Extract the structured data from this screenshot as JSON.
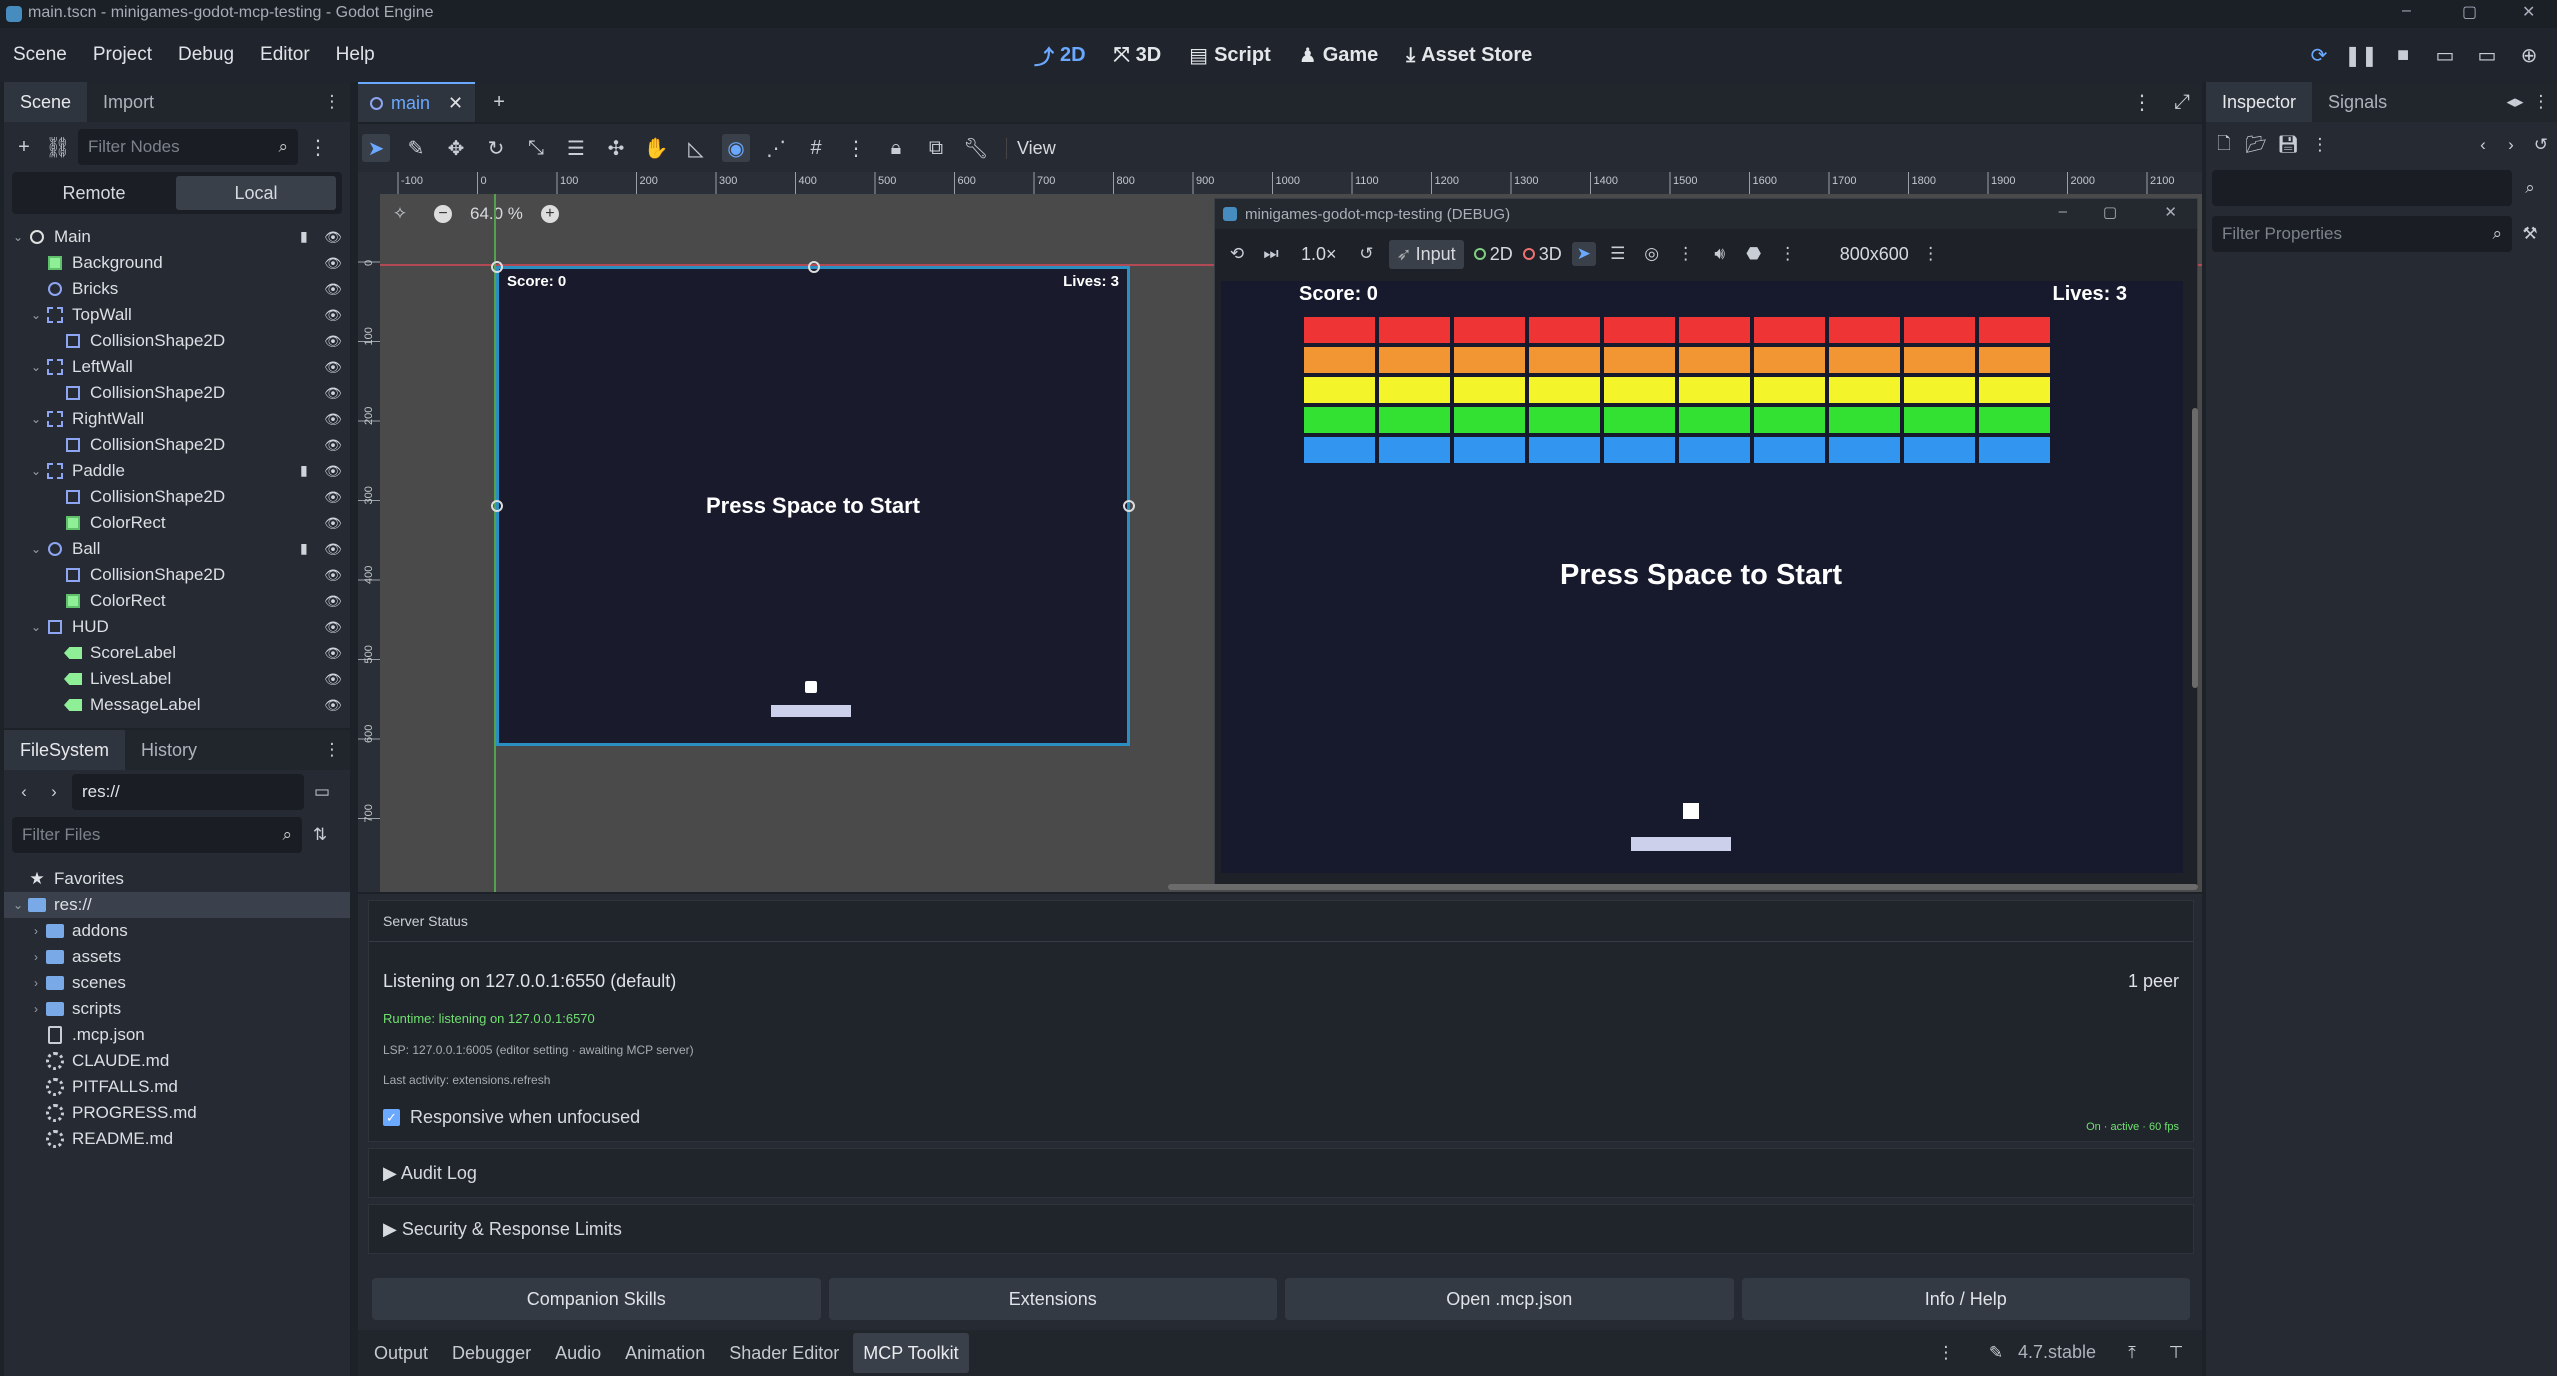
{
  "window": {
    "title": "main.tscn - minigames-godot-mcp-testing - Godot Engine"
  },
  "menu": [
    "Scene",
    "Project",
    "Debug",
    "Editor",
    "Help"
  ],
  "workspaces": [
    {
      "label": "2D",
      "icon": "2d-icon",
      "active": true
    },
    {
      "label": "3D",
      "icon": "3d-icon",
      "active": false
    },
    {
      "label": "Script",
      "icon": "script-icon",
      "active": false
    },
    {
      "label": "Game",
      "icon": "game-icon",
      "active": false
    },
    {
      "label": "Asset Store",
      "icon": "asset-store-icon",
      "active": false
    }
  ],
  "scene_dock": {
    "tabs": [
      "Scene",
      "Import"
    ],
    "filter_placeholder": "Filter Nodes",
    "remote_label": "Remote",
    "local_label": "Local",
    "nodes": [
      {
        "name": "Main",
        "depth": 0,
        "icon": "node",
        "expanded": true,
        "script": true
      },
      {
        "name": "Background",
        "depth": 1,
        "icon": "colorrect"
      },
      {
        "name": "Bricks",
        "depth": 1,
        "icon": "node2d"
      },
      {
        "name": "TopWall",
        "depth": 1,
        "icon": "body",
        "expanded": true
      },
      {
        "name": "CollisionShape2D",
        "depth": 2,
        "icon": "shape"
      },
      {
        "name": "LeftWall",
        "depth": 1,
        "icon": "body",
        "expanded": true
      },
      {
        "name": "CollisionShape2D",
        "depth": 2,
        "icon": "shape"
      },
      {
        "name": "RightWall",
        "depth": 1,
        "icon": "body",
        "expanded": true
      },
      {
        "name": "CollisionShape2D",
        "depth": 2,
        "icon": "shape"
      },
      {
        "name": "Paddle",
        "depth": 1,
        "icon": "body",
        "expanded": true,
        "script": true
      },
      {
        "name": "CollisionShape2D",
        "depth": 2,
        "icon": "shape"
      },
      {
        "name": "ColorRect",
        "depth": 2,
        "icon": "colorrect"
      },
      {
        "name": "Ball",
        "depth": 1,
        "icon": "ball",
        "expanded": true,
        "script": true
      },
      {
        "name": "CollisionShape2D",
        "depth": 2,
        "icon": "shape"
      },
      {
        "name": "ColorRect",
        "depth": 2,
        "icon": "colorrect"
      },
      {
        "name": "HUD",
        "depth": 1,
        "icon": "canvas",
        "expanded": true
      },
      {
        "name": "ScoreLabel",
        "depth": 2,
        "icon": "label"
      },
      {
        "name": "LivesLabel",
        "depth": 2,
        "icon": "label"
      },
      {
        "name": "MessageLabel",
        "depth": 2,
        "icon": "label"
      }
    ]
  },
  "filesystem": {
    "tabs": [
      "FileSystem",
      "History"
    ],
    "path": "res://",
    "filter_placeholder": "Filter Files",
    "items": [
      {
        "name": "Favorites",
        "depth": 0,
        "type": "fav"
      },
      {
        "name": "res://",
        "depth": 0,
        "type": "folder",
        "selected": true
      },
      {
        "name": "addons",
        "depth": 1,
        "type": "folder"
      },
      {
        "name": "assets",
        "depth": 1,
        "type": "folder"
      },
      {
        "name": "scenes",
        "depth": 1,
        "type": "folder"
      },
      {
        "name": "scripts",
        "depth": 1,
        "type": "folder"
      },
      {
        "name": ".mcp.json",
        "depth": 1,
        "type": "file"
      },
      {
        "name": "CLAUDE.md",
        "depth": 1,
        "type": "gear"
      },
      {
        "name": "PITFALLS.md",
        "depth": 1,
        "type": "gear"
      },
      {
        "name": "PROGRESS.md",
        "depth": 1,
        "type": "gear"
      },
      {
        "name": "README.md",
        "depth": 1,
        "type": "gear"
      }
    ]
  },
  "editor": {
    "tab_label": "main",
    "view_label": "View",
    "zoom": "64.0 %",
    "ruler_h": [
      "-100",
      "0",
      "100",
      "200",
      "300",
      "400",
      "500",
      "600",
      "700",
      "800",
      "900",
      "1000",
      "1100",
      "1200",
      "1300",
      "1400",
      "1500",
      "1600",
      "1700",
      "1800",
      "1900",
      "2000",
      "2100"
    ],
    "ruler_v": [
      "0",
      "100",
      "200",
      "300",
      "400",
      "500",
      "600",
      "700"
    ],
    "canvas": {
      "score": "Score: 0",
      "lives": "Lives: 3",
      "message": "Press Space to Start"
    }
  },
  "game_window": {
    "title": "minigames-godot-mcp-testing (DEBUG)",
    "speed": "1.0×",
    "input_label": "Input",
    "mode_2d": "2D",
    "mode_3d": "3D",
    "resolution": "800x600",
    "score": "Score: 0",
    "lives": "Lives: 3",
    "message": "Press Space to Start",
    "brick_colors": [
      "#ee3434",
      "#f29633",
      "#f4f42a",
      "#33e133",
      "#3296f0"
    ],
    "brick_columns": 10
  },
  "mcp_panel": {
    "section_title": "Server Status",
    "listening": "Listening on 127.0.0.1:6550 (default)",
    "peers": "1 peer",
    "runtime": "Runtime: listening on 127.0.0.1:6570",
    "lsp": "LSP: 127.0.0.1:6005 (editor setting · awaiting MCP server)",
    "last_activity": "Last activity: extensions.refresh",
    "responsive_label": "Responsive when unfocused",
    "fps_status": "On · active · 60 fps",
    "audit_log": "▶ Audit Log",
    "security": "▶ Security & Response Limits",
    "buttons": [
      "Companion Skills",
      "Extensions",
      "Open .mcp.json",
      "Info / Help"
    ]
  },
  "bottom_tabs": [
    "Output",
    "Debugger",
    "Audio",
    "Animation",
    "Shader Editor",
    "MCP Toolkit"
  ],
  "version": "4.7.stable",
  "inspector": {
    "tabs": [
      "Inspector",
      "Signals"
    ],
    "filter_placeholder": "Filter Properties"
  },
  "colors": {
    "accent": "#6aa9ff",
    "game_bg": "#171a2d",
    "runtime_green": "#6fe06f"
  }
}
